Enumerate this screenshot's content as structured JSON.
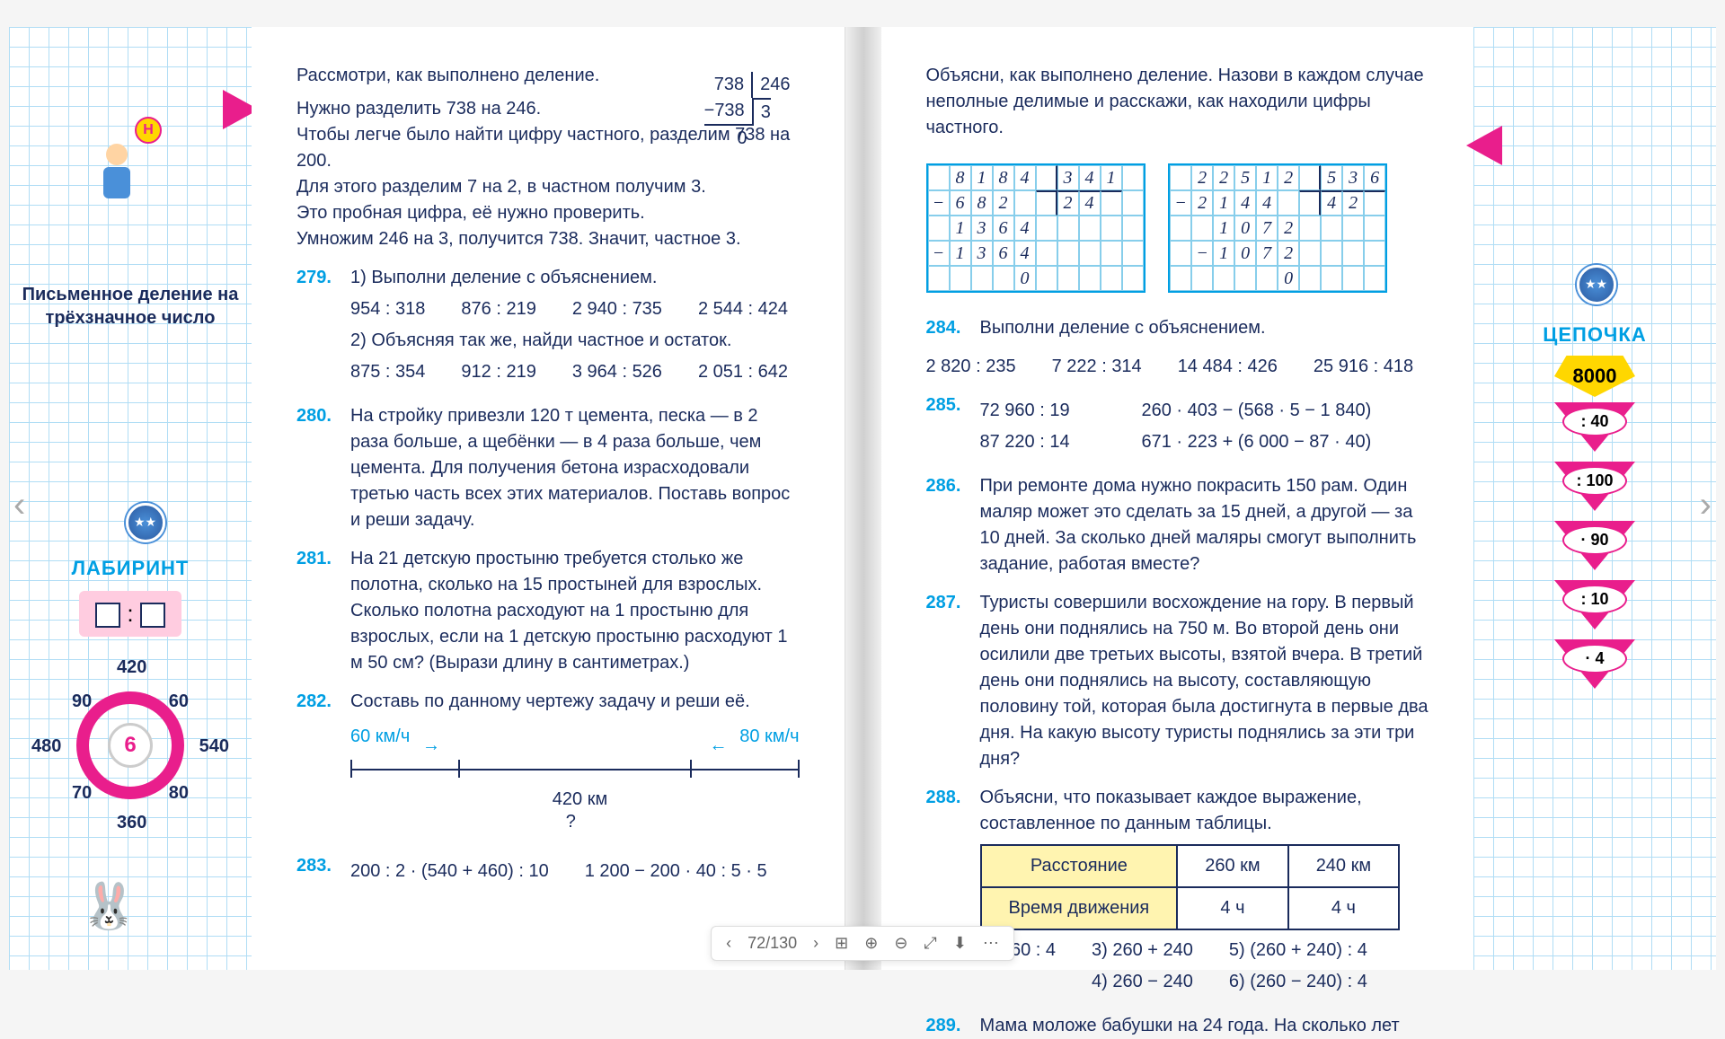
{
  "toolbar": {
    "page": "72/130"
  },
  "left_sidebar": {
    "title": "Письменное деление на трёхзначное число",
    "lab": "ЛАБИРИНТ",
    "circle": {
      "center": "6",
      "n": [
        "420",
        "60",
        "540",
        "80",
        "360",
        "70",
        "480",
        "90"
      ]
    }
  },
  "right_sidebar": {
    "title": "ЦЕПОЧКА",
    "start": "8000",
    "steps": [
      ": 40",
      ": 100",
      "· 90",
      ": 10",
      "· 4"
    ]
  },
  "intro": {
    "l1": "Рассмотри, как выполнено деление.",
    "l2": "Нужно разделить 738 на 246.",
    "l3": "Чтобы легче было найти цифру частного, разделим 738 на 200.",
    "l4": "Для этого разделим 7 на 2, в частном получим 3.",
    "l5": "Это пробная цифра, её нужно проверить.",
    "l6": "Умножим 246 на 3, получится 738. Значит, частное 3.",
    "div": {
      "a": "738",
      "b": "246",
      "s": "738",
      "q": "3",
      "r": "0"
    }
  },
  "p279": {
    "t1": "1) Выполни деление с объяснением.",
    "r1": [
      "954 : 318",
      "876 : 219",
      "2 940 : 735",
      "2 544 : 424"
    ],
    "t2": "2) Объясняя так же, найди частное и остаток.",
    "r2": [
      "875 : 354",
      "912 : 219",
      "3 964 : 526",
      "2 051 : 642"
    ]
  },
  "p280": "На стройку привезли 120 т цемента, песка — в 2 раза больше, а щебёнки — в 4 раза больше, чем цемента. Для получения бетона израсходовали третью часть всех этих материалов. Поставь вопрос и реши задачу.",
  "p281": "На 21 детскую простыню требуется столько же полотна, сколько на 15 простыней для взрослых. Сколько полотна расходуют на 1 простыню для взрослых, если на 1 детскую простыню расходуют 1 м 50 см? (Вырази длину в сантиметрах.)",
  "p282": {
    "t": "Составь по данному чертежу задачу и реши её.",
    "s1": "60 км/ч",
    "s2": "80 км/ч",
    "d": "420 км",
    "q": "?"
  },
  "p283": {
    "a": "200 : 2 · (540 + 460) : 10",
    "b": "1 200 − 200 · 40 : 5 · 5"
  },
  "intro2": "Объясни, как выполнено деление. Назови в каждом случае неполные делимые и расскажи, как находили цифры частного.",
  "p284": {
    "t": "Выполни деление с объяснением.",
    "r": [
      "2 820 : 235",
      "7 222 : 314",
      "14 484 : 426",
      "25 916 : 418"
    ]
  },
  "p285": {
    "r1": [
      "72 960 : 19",
      "260 · 403 − (568 · 5 − 1 840)"
    ],
    "r2": [
      "87 220 : 14",
      "671 · 223 + (6 000 − 87 · 40)"
    ]
  },
  "p286": "При ремонте дома нужно покрасить 150 рам. Один маляр может это сделать за 15 дней, а другой — за 10 дней. За сколько дней маляры смогут выполнить задание, работая вместе?",
  "p287": "Туристы совершили восхождение на гору. В первый день они поднялись на 750 м. Во второй день они осилили две третьих высоты, взятой вчера. В третий день они поднялись на высоту, составляющую половину той, которая была достигнута в первые два дня. На какую высоту туристы поднялись за эти три дня?",
  "p288": {
    "t": "Объясни, что показывает каждое выражение, составленное по данным таблицы.",
    "h1": "Расстояние",
    "h2": "Время движения",
    "c": [
      "260 км",
      "240 км",
      "4 ч",
      "4 ч"
    ],
    "e": [
      "1) 260 : 4",
      "3) 260 + 240",
      "5) (260 + 240) : 4",
      "4) 260 − 240",
      "6) (260 − 240) : 4"
    ]
  },
  "p289": "Мама моложе бабушки на 24 года. На сколько лет"
}
